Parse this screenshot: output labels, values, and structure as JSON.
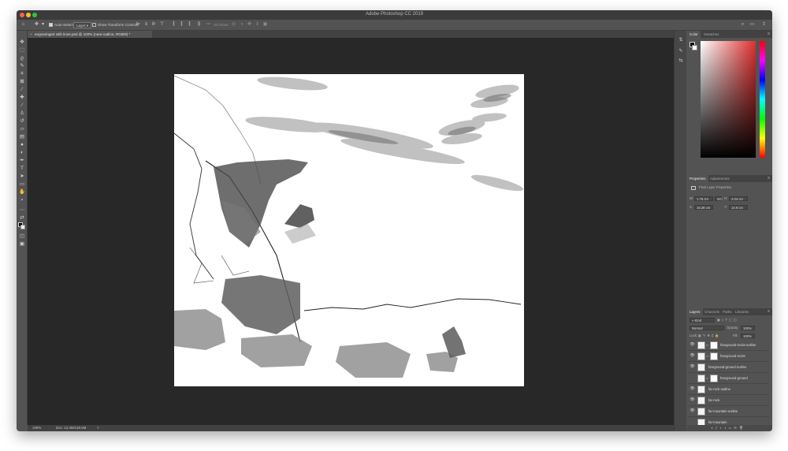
{
  "app": {
    "title": "Adobe Photoshop CC 2019"
  },
  "options_bar": {
    "auto_select_label": "Auto-Select:",
    "auto_select_value": "Layer",
    "show_transform_label": "Show Transform Controls",
    "mode_3d_label": "3D Mode:"
  },
  "document": {
    "tab_label": "engravingart with lines.psd @ 100% (near-outline, RGB/8) *",
    "close_glyph": "×"
  },
  "status_bar": {
    "zoom": "100%",
    "doc_size": "Doc: 12.4M/148.5M",
    "arrow": ">"
  },
  "color_panel": {
    "tabs": [
      "Color",
      "Swatches"
    ],
    "foreground": "#000000",
    "background": "#ffffff",
    "hue_color": "#e03030"
  },
  "properties_panel": {
    "tabs": [
      "Properties",
      "Adjustments"
    ],
    "section_label": "Pixel Layer Properties",
    "w_label": "W:",
    "w_value": "1.76 cm",
    "go_label": "GO",
    "h_label": "H:",
    "h_value": "2.04 cm",
    "x_label": "X:",
    "x_value": "15.28 cm",
    "y_label": "Y:",
    "y_value": "14.9 cm"
  },
  "layers_panel": {
    "tabs": [
      "Layers",
      "Channels",
      "Paths",
      "Libraries"
    ],
    "filter_label": "Kind",
    "blend_mode": "Normal",
    "opacity_label": "Opacity:",
    "opacity_value": "100%",
    "lock_label": "Lock:",
    "fill_label": "Fill:",
    "fill_value": "100%",
    "layers": [
      {
        "name": "foreground-rocks-outline",
        "visible": true,
        "has_mask": true
      },
      {
        "name": "foreground-rocks",
        "visible": true,
        "has_mask": true
      },
      {
        "name": "foreground-ground-outline",
        "visible": true,
        "has_mask": false
      },
      {
        "name": "foreground-ground",
        "visible": false,
        "has_mask": true
      },
      {
        "name": "far-rock-outline",
        "visible": true,
        "has_mask": false
      },
      {
        "name": "far-rock",
        "visible": true,
        "has_mask": false
      },
      {
        "name": "far-mountain-outline",
        "visible": true,
        "has_mask": false
      },
      {
        "name": "far-mountain",
        "visible": false,
        "has_mask": false
      }
    ]
  },
  "icons": {
    "home": "home-icon",
    "search": "search-icon",
    "share": "share-icon"
  }
}
